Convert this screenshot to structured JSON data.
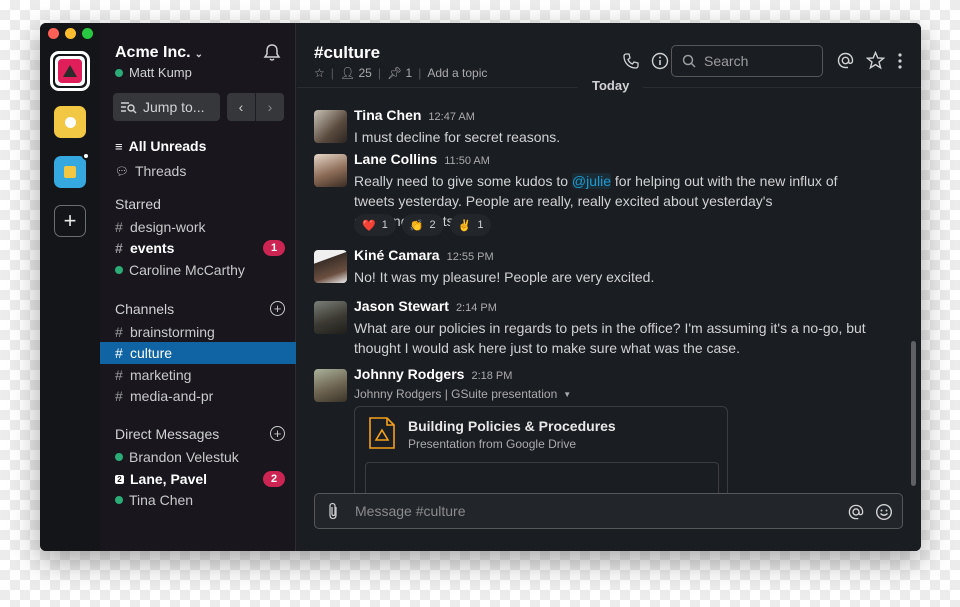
{
  "colors": {
    "accent_active": "#1164a3",
    "badge": "#cd2553",
    "presence": "#2bac76",
    "mention": "#1d9bd1"
  },
  "workspace_rail": {
    "workspaces": [
      {
        "icon": "red-triangle-workspace-icon",
        "active": true
      },
      {
        "icon": "yellow-workspace-icon",
        "active": false
      },
      {
        "icon": "blue-workspace-icon",
        "active": false,
        "unread_dot": true
      }
    ],
    "add_label": "+"
  },
  "sidebar": {
    "team_name": "Acme Inc.",
    "user_name": "Matt Kump",
    "jump_label": "Jump to...",
    "top_items": [
      {
        "label": "All Unreads",
        "icon": "all-unreads-icon"
      },
      {
        "label": "Threads",
        "icon": "threads-icon"
      }
    ],
    "starred_title": "Starred",
    "starred": [
      {
        "label": "design-work",
        "type": "channel"
      },
      {
        "label": "events",
        "type": "channel",
        "badge": "1"
      },
      {
        "label": "Caroline McCarthy",
        "type": "dm"
      }
    ],
    "channels_title": "Channels",
    "channels": [
      {
        "label": "brainstorming"
      },
      {
        "label": "culture",
        "active": true
      },
      {
        "label": "marketing"
      },
      {
        "label": "media-and-pr"
      }
    ],
    "dms_title": "Direct Messages",
    "dms": [
      {
        "label": "Brandon Velestuk"
      },
      {
        "label": "Lane, Pavel",
        "group_count": "2",
        "badge": "2"
      },
      {
        "label": "Tina Chen"
      }
    ]
  },
  "channel_header": {
    "title": "#culture",
    "members": "25",
    "pins": "1",
    "add_topic": "Add a topic",
    "search_placeholder": "Search"
  },
  "date_divider": "Today",
  "messages": [
    {
      "name": "Tina Chen",
      "time": "12:47 AM",
      "text": "I must decline for secret reasons."
    },
    {
      "name": "Lane Collins",
      "time": "11:50 AM",
      "text_before": "Really need to give some kudos to ",
      "mention": "@julie",
      "text_after": " for helping out with the new influx of tweets yesterday. People are really, really excited about yesterday's announcements.",
      "reactions": [
        {
          "emoji": "❤️",
          "count": "1"
        },
        {
          "emoji": "👏",
          "count": "2"
        },
        {
          "emoji": "✌️",
          "count": "1"
        }
      ]
    },
    {
      "name": "Kiné Camara",
      "time": "12:55 PM",
      "text": "No! It was my pleasure! People are very excited."
    },
    {
      "name": "Jason Stewart",
      "time": "2:14 PM",
      "text": "What are our policies in regards to pets in the office? I'm assuming it's a no-go, but thought I would ask here just to make sure what was the case."
    },
    {
      "name": "Johnny Rodgers",
      "time": "2:18 PM",
      "subtitle": "Johnny Rodgers | GSuite presentation",
      "attachment": {
        "title": "Building Policies & Procedures",
        "subtitle": "Presentation from Google Drive"
      }
    }
  ],
  "composer": {
    "placeholder": "Message #culture"
  }
}
